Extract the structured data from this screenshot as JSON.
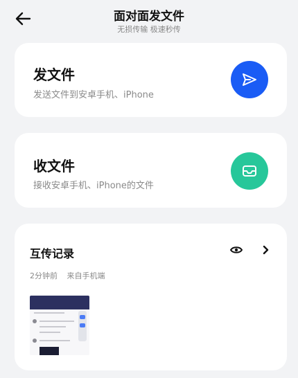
{
  "header": {
    "title": "面对面发文件",
    "subtitle": "无损传输 极速秒传"
  },
  "send_card": {
    "title": "发文件",
    "desc": "发送文件到安卓手机、iPhone",
    "icon": "send-icon",
    "accent": "#1a5cf5"
  },
  "recv_card": {
    "title": "收文件",
    "desc": "接收安卓手机、iPhone的文件",
    "icon": "inbox-icon",
    "accent": "#27c79a"
  },
  "history": {
    "title": "互传记录",
    "time": "2分钟前",
    "source": "来自手机端"
  }
}
